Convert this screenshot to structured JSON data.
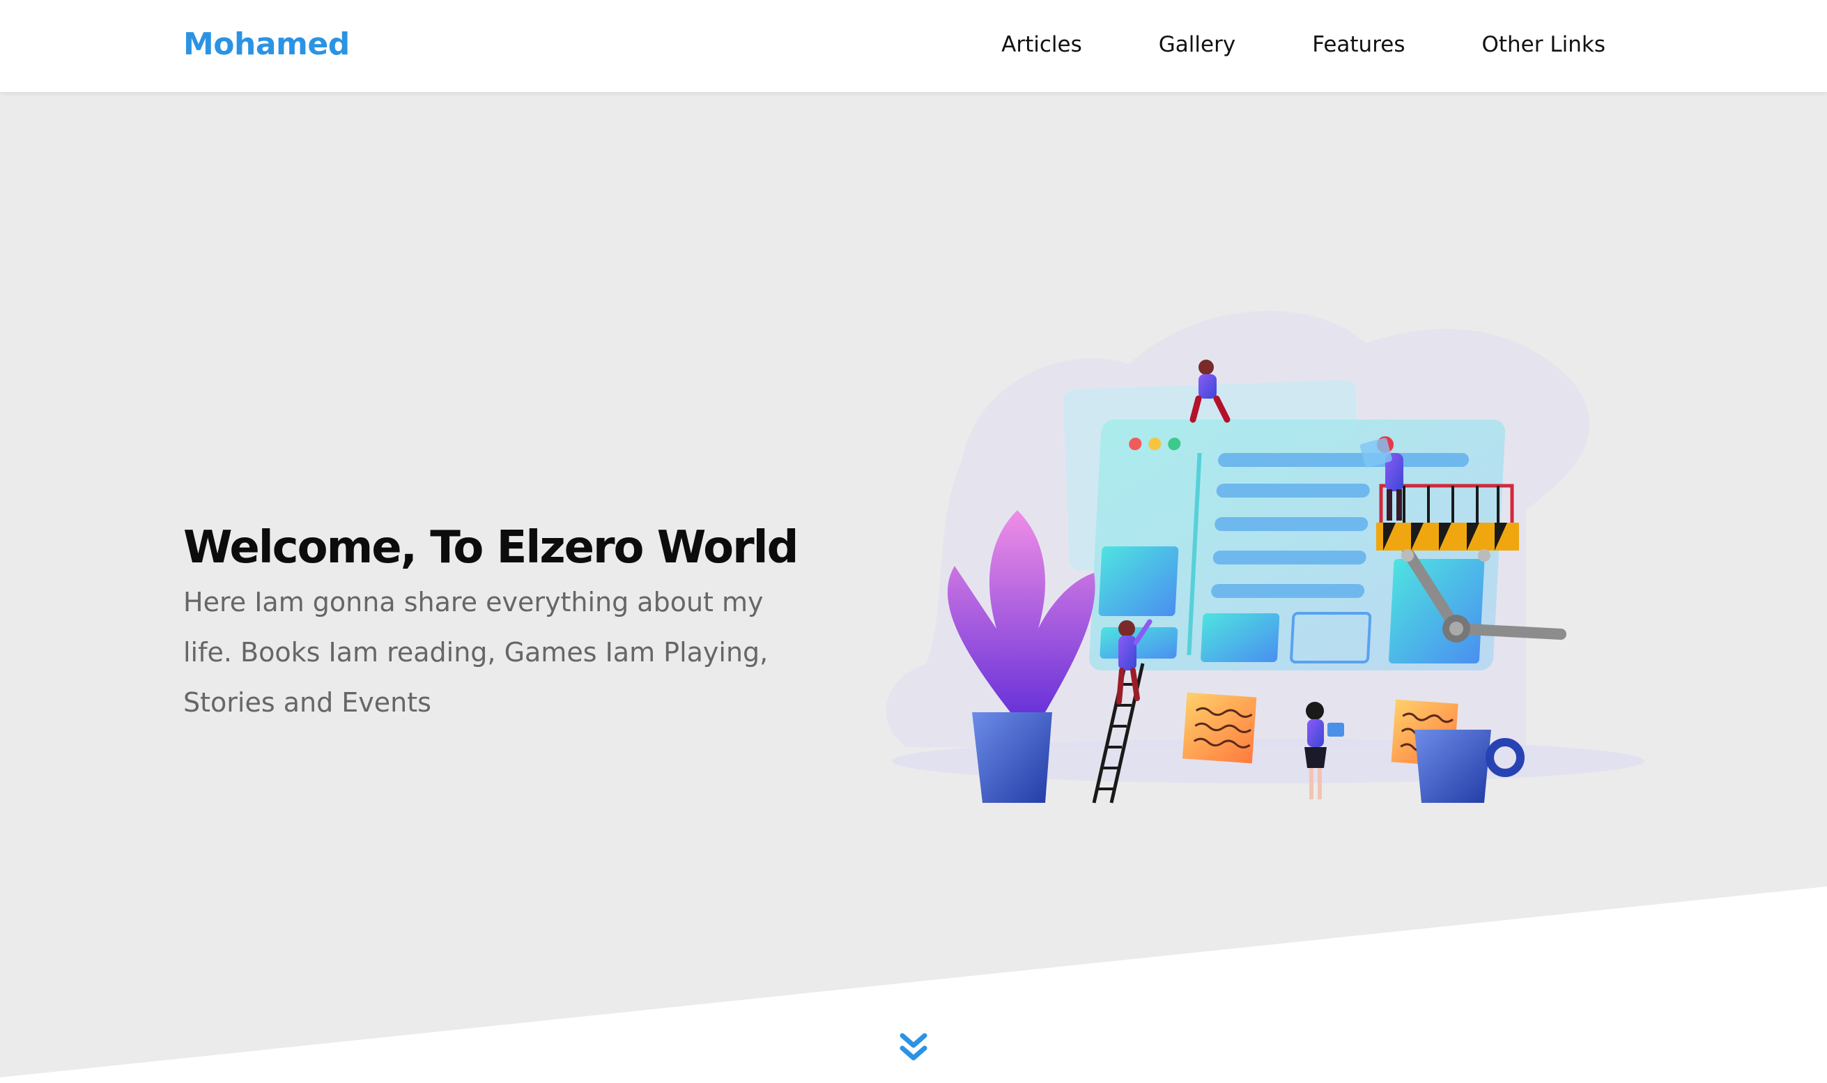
{
  "header": {
    "logo": "Mohamed",
    "nav": [
      {
        "label": "Articles"
      },
      {
        "label": "Gallery"
      },
      {
        "label": "Features"
      },
      {
        "label": "Other Links"
      }
    ]
  },
  "hero": {
    "title": "Welcome, To Elzero World",
    "description": "Here Iam gonna share everything about my life. Books Iam reading, Games Iam Playing, Stories and Events",
    "illustration_icon": "team-building-website-illustration",
    "scroll_icon": "double-chevron-down-icon"
  },
  "colors": {
    "brand": "#2b93e3",
    "landing_background": "#ebebeb",
    "text_dark": "#0c0c0c",
    "text_muted": "#666666"
  }
}
